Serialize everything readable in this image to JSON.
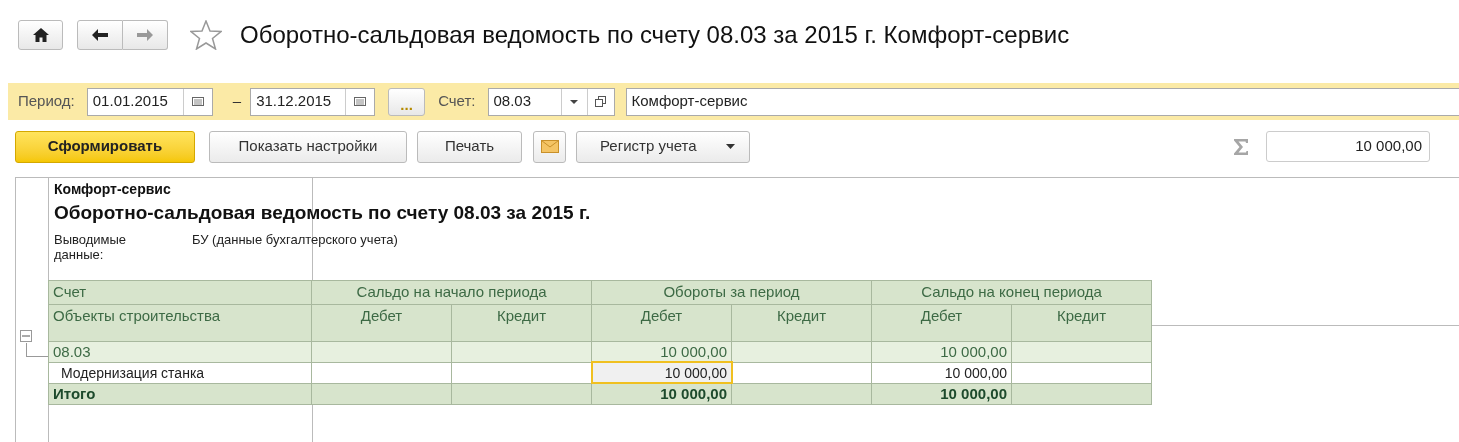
{
  "window": {
    "title": "Оборотно-сальдовая ведомость по счету 08.03 за 2015 г. Комфорт-сервис",
    "favorite": false
  },
  "filters": {
    "period_label": "Период:",
    "date_from": "01.01.2015",
    "dash": "–",
    "date_to": "31.12.2015",
    "more_button": "...",
    "account_label": "Счет:",
    "account": "08.03",
    "organization": "Комфорт-сервис"
  },
  "toolbar": {
    "buttons": [
      {
        "kind": "primary",
        "label": "Сформировать"
      },
      {
        "kind": "plain",
        "label": "Показать настройки"
      },
      {
        "kind": "plain",
        "label": "Печать"
      },
      {
        "kind": "mail"
      },
      {
        "kind": "dropdown",
        "label": "Регистр учета"
      }
    ],
    "sum": "10 000,00"
  },
  "report": {
    "organization": "Комфорт-сервис",
    "title": "Оборотно-сальдовая ведомость по счету 08.03 за 2015 г.",
    "output_label": "Выводимые данные:",
    "output_value": "БУ (данные бухгалтерского учета)",
    "header_row_1": [
      "Счет",
      "Сальдо на начало периода",
      "Обороты за период",
      "Сальдо на конец периода"
    ],
    "header_row_2": [
      "Объекты строительства",
      "Дебет",
      "Кредит",
      "Дебет",
      "Кредит",
      "Дебет",
      "Кредит"
    ],
    "rows": [
      {
        "kind": "group",
        "expanded": true,
        "cells": [
          {
            "text": "08.03",
            "selected": false
          },
          {
            "selected": false
          },
          {
            "selected": false
          },
          {
            "text": "10 000,00",
            "selected": false
          },
          {
            "selected": false
          },
          {
            "text": "10 000,00",
            "selected": false
          },
          {
            "selected": false
          }
        ]
      },
      {
        "kind": "item",
        "cells": [
          {
            "text": "Модернизация станка",
            "selected": false
          },
          {
            "selected": false
          },
          {
            "selected": false
          },
          {
            "text": "10 000,00",
            "selected": true
          },
          {
            "selected": false
          },
          {
            "text": "10 000,00",
            "selected": false
          },
          {
            "selected": false
          }
        ]
      },
      {
        "kind": "total",
        "cells": [
          {
            "text": "Итого",
            "selected": false
          },
          {
            "selected": false
          },
          {
            "selected": false
          },
          {
            "text": "10 000,00",
            "selected": false
          },
          {
            "selected": false
          },
          {
            "text": "10 000,00",
            "selected": false
          },
          {
            "selected": false
          }
        ]
      }
    ]
  }
}
